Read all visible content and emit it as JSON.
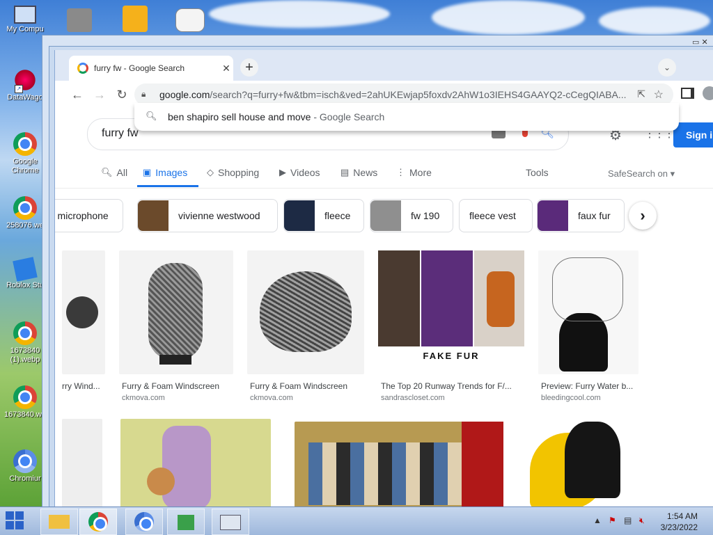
{
  "desktop": {
    "icons": [
      {
        "label": "My Compu",
        "name": "my-computer-icon"
      },
      {
        "label": "DataWago",
        "name": "datawagon-icon"
      },
      {
        "label": "Google Chrome",
        "name": "google-chrome-icon"
      },
      {
        "label": "258076.we",
        "name": "file-258076-icon"
      },
      {
        "label": "Roblox Stu",
        "name": "roblox-studio-icon"
      },
      {
        "label": "1673840 (1).webp",
        "name": "file-1673840-1-icon"
      },
      {
        "label": "1673840.we",
        "name": "file-1673840-icon"
      },
      {
        "label": "Chromiur",
        "name": "chromium-icon"
      }
    ]
  },
  "browser": {
    "tab": {
      "title": "furry fw - Google Search",
      "close": "✕"
    },
    "new_tab": "+",
    "url_host": "google.com",
    "url_rest": "/search?q=furry+fw&tbm=isch&ved=2ahUKEwjap5foxdv2AhW1o3IEHS4GAAYQ2-cCegQIABA...",
    "suggestion": {
      "text": "ben shapiro sell house and move",
      "source": " - Google Search"
    }
  },
  "search": {
    "query": "furry fw",
    "signin": "Sign in",
    "tabs": [
      "All",
      "Images",
      "Shopping",
      "Videos",
      "News",
      "More"
    ],
    "tools": "Tools",
    "safesearch": "SafeSearch on ▾"
  },
  "chips": [
    "r microphone",
    "vivienne westwood",
    "fleece",
    "fw 190",
    "fleece vest",
    "faux fur"
  ],
  "results": [
    {
      "caption": "rry Wind...",
      "site": ""
    },
    {
      "caption": "Furry & Foam Windscreen",
      "site": "ckmova.com"
    },
    {
      "caption": "Furry & Foam Windscreen",
      "site": "ckmova.com"
    },
    {
      "caption": "The Top 20 Runway Trends for F/...",
      "site": "sandrascloset.com",
      "overlay": "FAKE FUR"
    },
    {
      "caption": "Preview: Furry Water b...",
      "site": "bleedingcool.com"
    }
  ],
  "taskbar": {
    "time": "1:54 AM",
    "date": "3/23/2022"
  }
}
